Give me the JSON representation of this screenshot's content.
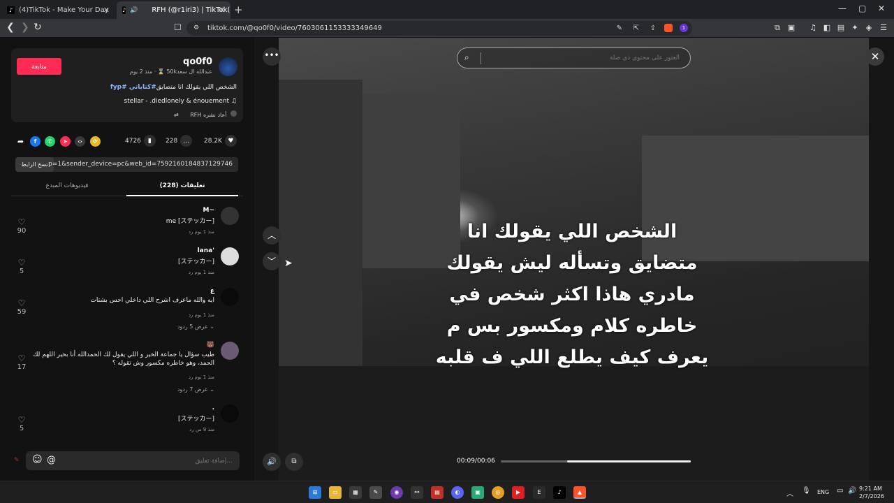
{
  "browser": {
    "tabs": [
      {
        "title": "(4)TikTok - Make Your Day",
        "active": false
      },
      {
        "title": "RFH (@r1iri3) | TikTok(4)",
        "active": true
      }
    ],
    "new_tab": "+",
    "url": "tiktok.com/@qo0f0/video/7603061153333349649",
    "ext_badge": "1"
  },
  "author": {
    "name": "qo0f0",
    "meta": "عبدالله ال سعد50k ⌛ · منذ 2 يوم",
    "follow_label": "متابعة",
    "caption_text": "الشخص اللي يقولك انا متضايق",
    "caption_tags": "#كتاباتي #fyp",
    "music": "stellar - .diedlonely & énouement ♫",
    "repost": "RFH أعاد نشره"
  },
  "actions": {
    "likes": "28.2K",
    "comments": "228",
    "saves": "4726"
  },
  "link": {
    "copy_label": "نسخ الرابط",
    "text": "...p=1&sender_device=pc&web_id=7592160184837129746"
  },
  "tabs": {
    "comments": "(228) تعليقات",
    "creator_videos": "فيديوهات المبدع"
  },
  "comments": [
    {
      "name": "M~",
      "text": "me [ステッカー]",
      "meta": "منذ 1 يوم    رد",
      "likes": "90",
      "replies": ""
    },
    {
      "name": "lana'",
      "text": "[ステッカー]",
      "meta": "منذ 1 يوم    رد",
      "likes": "5",
      "replies": ""
    },
    {
      "name": "ع",
      "text": "ايه والله ماعرف اشرح اللي داخلي احس بشتات",
      "meta": "منذ 1 يوم    رد",
      "likes": "59",
      "replies": "عرض 5 ردود ⌄"
    },
    {
      "name": "🐻",
      "text": "طيب سؤال يا جماعة الخير و اللي يقول لك الحمدالله أنا بخير اللهم لك الحمد، وهو خاطره مكسور وش تقوله ؟",
      "meta": "منذ 1 يوم    رد",
      "likes": "17",
      "replies": "عرض 7 ردود ⌄"
    },
    {
      "name": ".",
      "text": "[ステッカー]",
      "meta": "منذ 9 س    رد",
      "likes": "5",
      "replies": ""
    }
  ],
  "comment_input": {
    "placeholder": "إضافة تعليق..."
  },
  "video": {
    "search_placeholder": "العثور على محتوى ذي صلة",
    "caption_lines": [
      "الشخص اللي يقولك انا",
      "متضايق وتسأله ليش يقولك",
      "مادري هاذا اكثر شخص في",
      "خاطره كلام ومكسور بس م",
      "يعرف كيف يطلع اللي ف قلبه"
    ],
    "time": "00:09/00:06",
    "progress_fraction": 0.65
  },
  "taskbar": {
    "lang": "ENG",
    "time": "9:21 AM",
    "date": "2/7/2026"
  },
  "colors": {
    "accent": "#fe2c55",
    "tag": "#8ab4ff"
  }
}
